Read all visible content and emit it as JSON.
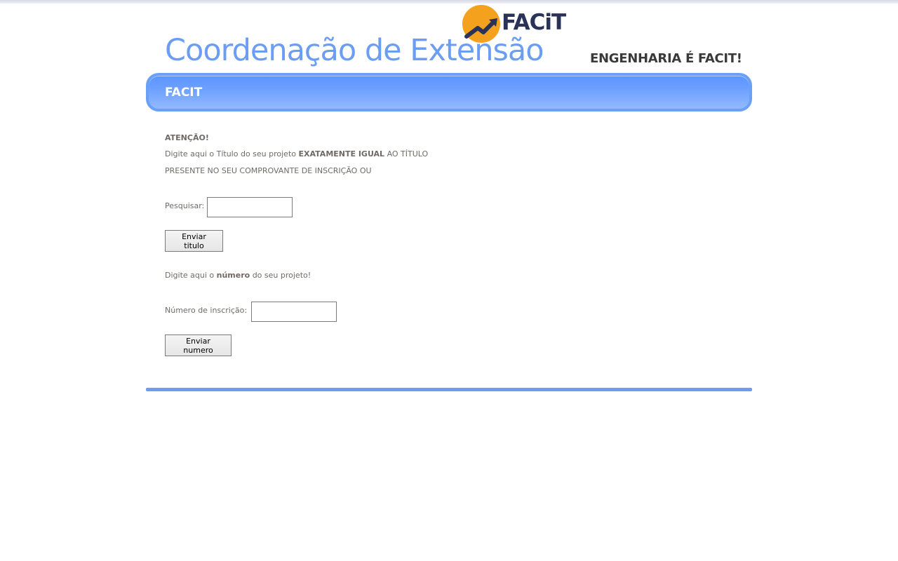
{
  "brand": {
    "logo_text": "FACiT",
    "title": "Coordenação de Extensão",
    "tagline": "ENGENHARIA É FACIT!"
  },
  "banner": {
    "title": "FACIT"
  },
  "notice": {
    "heading": "ATENÇÃO!",
    "line1_prefix": "Digite aqui o Título do seu projeto ",
    "line1_emphasis": "EXATAMENTE IGUAL",
    "line1_suffix": " AO TÍTULO",
    "line2": "PRESENTE NO SEU COMPROVANTE DE INSCRIÇÃO OU"
  },
  "search": {
    "label": "Pesquisar:",
    "value": "",
    "button_label": "Enviar titulo"
  },
  "number": {
    "prompt_prefix": "Digite aqui o ",
    "prompt_emphasis": "número",
    "prompt_suffix": " do seu projeto!",
    "label": "Número de inscrição:",
    "value": "",
    "button_label": "Enviar numero"
  },
  "colors": {
    "accent": "#6b9df2",
    "logo_orange": "#f4a11d",
    "logo_navy": "#2b3258"
  }
}
